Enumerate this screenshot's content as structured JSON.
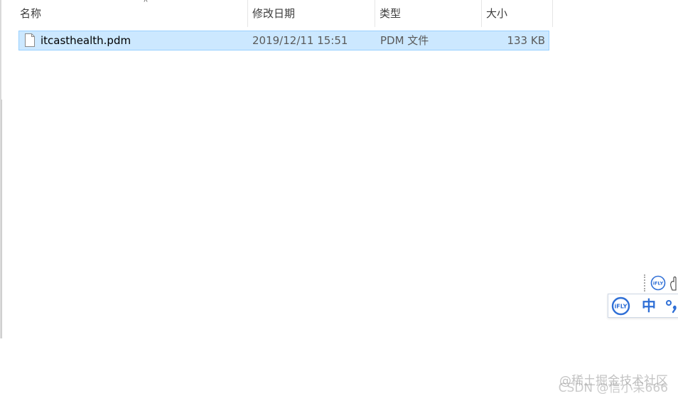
{
  "columns": {
    "name": "名称",
    "date": "修改日期",
    "type": "类型",
    "size": "大小",
    "sort_indicator": "^"
  },
  "files": [
    {
      "icon": "document-icon",
      "name": "itcasthealth.pdm",
      "modified": "2019/12/11 15:51",
      "type": "PDM 文件",
      "size": "133 KB",
      "selected": true
    }
  ],
  "ime": {
    "brand": "iFLY",
    "language_mode": "中",
    "accent_color": "#2f6fd6"
  },
  "watermark": {
    "line1": "@稀土掘金技术社区",
    "line2": "CSDN @信小呆666"
  },
  "colors": {
    "selection_bg": "#cce8ff",
    "selection_border": "#99d1ff"
  }
}
